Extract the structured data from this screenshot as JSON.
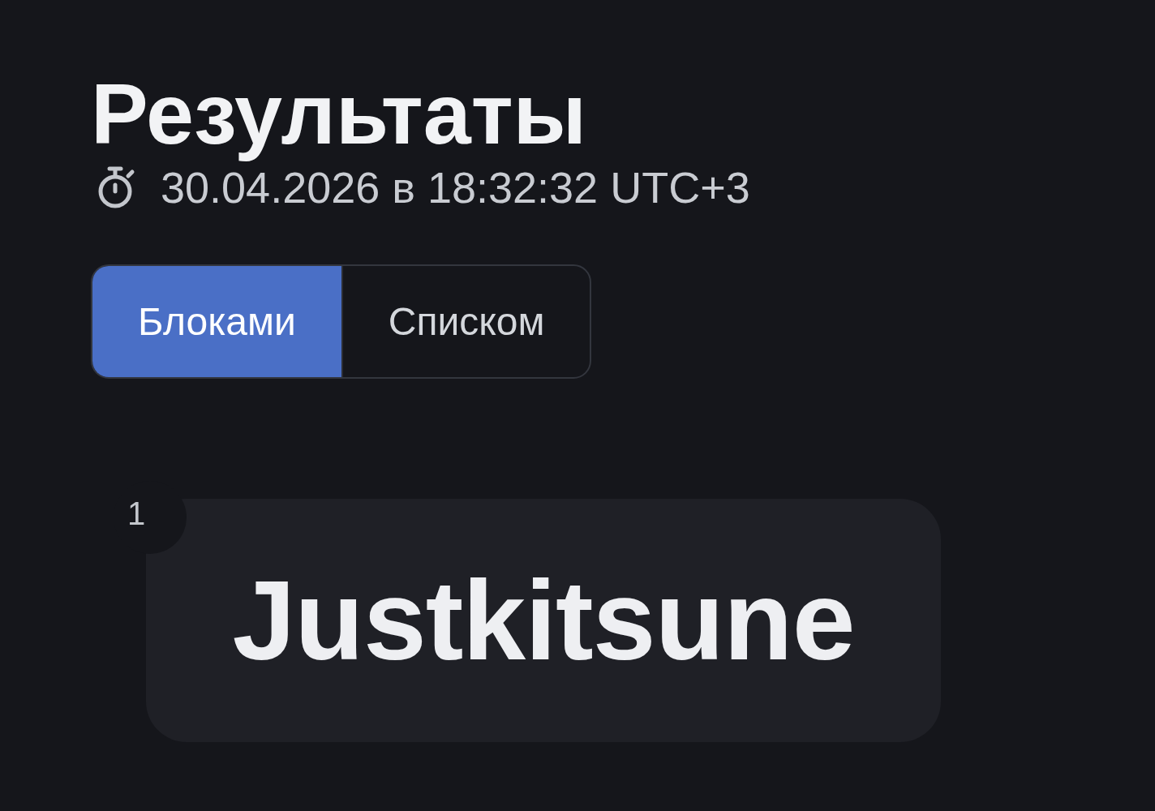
{
  "header": {
    "title": "Результаты",
    "timestamp": "30.04.2026 в 18:32:32 UTC+3"
  },
  "view_toggle": [
    {
      "label": "Блоками",
      "selected": true
    },
    {
      "label": "Списком",
      "selected": false
    }
  ],
  "results": [
    {
      "rank": "1",
      "name": "Justkitsune"
    }
  ]
}
